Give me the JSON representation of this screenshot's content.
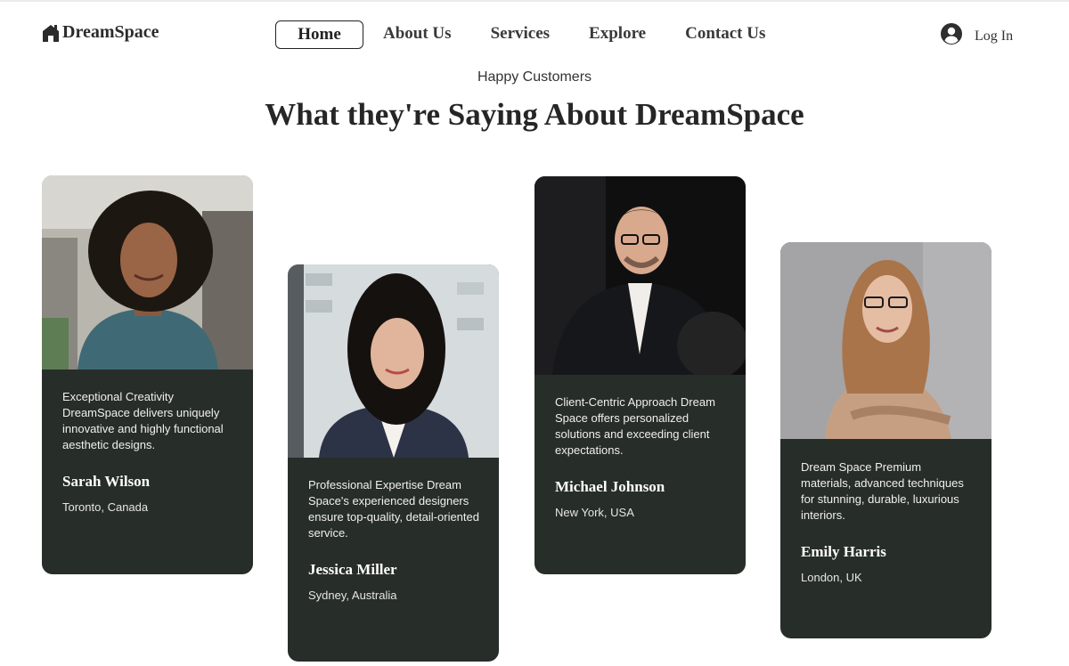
{
  "brand": {
    "name": "DreamSpace",
    "logo_icon": "house-icon"
  },
  "nav": {
    "items": [
      {
        "label": "Home",
        "active": true
      },
      {
        "label": "About Us"
      },
      {
        "label": "Services"
      },
      {
        "label": "Explore"
      },
      {
        "label": "Contact Us"
      }
    ]
  },
  "login": {
    "label": "Log In",
    "icon": "user-avatar-icon"
  },
  "section": {
    "eyebrow": "Happy Customers",
    "title": "What they're Saying About DreamSpace"
  },
  "testimonials": [
    {
      "quote": "Exceptional Creativity DreamSpace delivers uniquely innovative and highly functional aesthetic designs.",
      "name": "Sarah Wilson",
      "location": "Toronto, Canada"
    },
    {
      "quote": "Professional Expertise Dream Space's experienced designers ensure top-quality, detail-oriented service.",
      "name": "Jessica Miller",
      "location": "Sydney, Australia"
    },
    {
      "quote": "Client-Centric Approach Dream Space offers personalized solutions and exceeding client expectations.",
      "name": "Michael Johnson",
      "location": "New York, USA"
    },
    {
      "quote": "Dream Space Premium materials, advanced techniques for stunning, durable, luxurious interiors.",
      "name": "Emily Harris",
      "location": "London, UK"
    }
  ],
  "colors": {
    "card_bg": "#272d29",
    "text_dark": "#262626",
    "text_light": "#f0f0ee"
  }
}
